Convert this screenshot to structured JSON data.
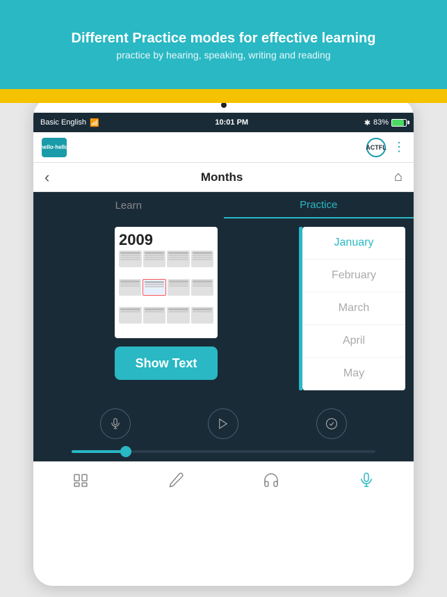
{
  "banner": {
    "title": "Different Practice modes for effective learning",
    "subtitle": "practice by hearing, speaking, writing and reading"
  },
  "status_bar": {
    "carrier": "Basic English",
    "time": "10:01 PM",
    "bluetooth": "✱",
    "battery_percent": "83%"
  },
  "app_header": {
    "logo_text": "hello·hello",
    "actfl_label": "ACTFL"
  },
  "nav": {
    "title": "Months",
    "back_icon": "‹",
    "home_icon": "⌂"
  },
  "tabs": {
    "learn_label": "Learn",
    "practice_label": "Practice"
  },
  "calendar": {
    "year": "2009"
  },
  "show_text_button": "Show Text",
  "months": [
    {
      "name": "January",
      "selected": true
    },
    {
      "name": "February",
      "selected": false
    },
    {
      "name": "March",
      "selected": false
    },
    {
      "name": "April",
      "selected": false
    },
    {
      "name": "May",
      "selected": false
    }
  ],
  "controls": {
    "mic_icon": "🎤",
    "play_icon": "▶",
    "check_icon": "✓"
  },
  "bottom_tabs": [
    {
      "label": "vocab",
      "icon": "🃏",
      "active": false
    },
    {
      "label": "write",
      "icon": "✏",
      "active": false
    },
    {
      "label": "listen",
      "icon": "🎧",
      "active": false
    },
    {
      "label": "speak",
      "icon": "🎤",
      "active": true
    }
  ]
}
